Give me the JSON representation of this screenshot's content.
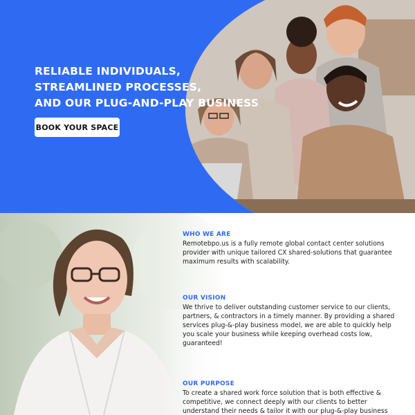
{
  "hero": {
    "title_lines": [
      "RELIABLE INDIVIDUALS,",
      "STREAMLINED PROCESSES,",
      "AND OUR PLUG-AND-PLAY BUSINESS"
    ],
    "cta_label": "BOOK YOUR SPACE"
  },
  "sections": [
    {
      "heading": "WHO WE ARE",
      "lines": [
        "Remotebpo.us is a fully remote global contact center solutions",
        "provider with unique tailored CX shared-solutions that guarantee",
        "maximum results with scalability."
      ]
    },
    {
      "heading": "OUR VISION",
      "lines": [
        "We thrive to deliver outstanding customer service to our clients,",
        "partners, & contractors in a timely manner. By providing a shared",
        "services plug-&-play business model, we are able to quickly help",
        "you scale your business while keeping overhead costs low,",
        "guaranteed!"
      ]
    },
    {
      "heading": "OUR PURPOSE",
      "lines": [
        "To create a shared work force solution that is both effective &",
        "competitive, we connect deeply with our clients to better",
        "understand their needs & tailor it with our plug-&-play business"
      ]
    }
  ],
  "colors": {
    "brand_blue": "#2f6bf2",
    "heading_blue": "#2f6bf2",
    "text": "#1e1e1e"
  }
}
